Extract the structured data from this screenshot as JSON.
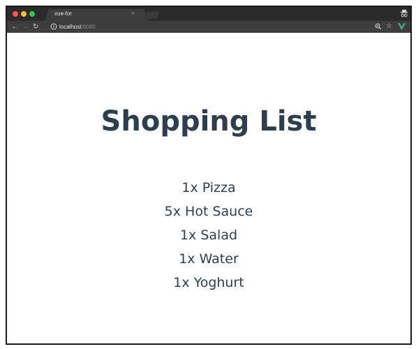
{
  "browser": {
    "tab_title": "vue-for",
    "tab_close": "×",
    "url_host": "localhost",
    "url_port": ":8080",
    "icons": [
      "back-arrow-icon",
      "forward-arrow-icon",
      "reload-icon",
      "info-icon",
      "zoom-icon",
      "star-icon",
      "vue-extension-icon",
      "menu-icon",
      "incognito-icon"
    ]
  },
  "page": {
    "title": "Shopping List",
    "items": [
      {
        "text": "1x Pizza"
      },
      {
        "text": "5x Hot Sauce"
      },
      {
        "text": "1x Salad"
      },
      {
        "text": "1x Water"
      },
      {
        "text": "1x Yoghurt"
      }
    ]
  },
  "colors": {
    "text": "#2c3e50",
    "vue_green": "#41b883",
    "chrome_dark": "#2b2b2b",
    "chrome_toolbar": "#3d3d3d"
  }
}
